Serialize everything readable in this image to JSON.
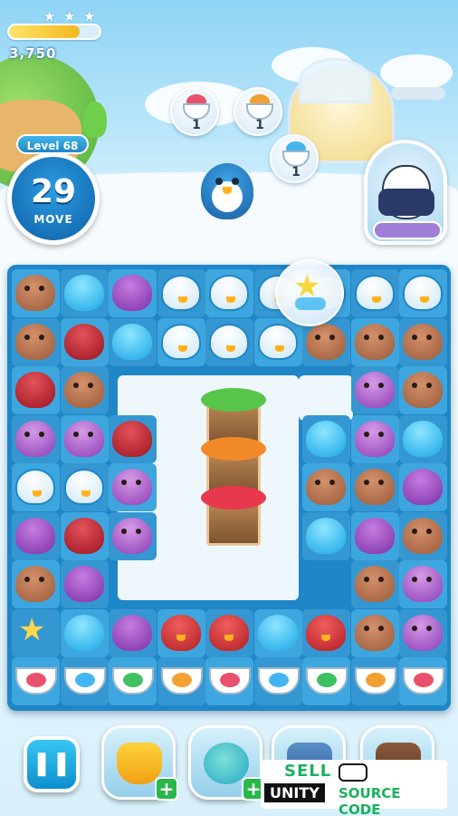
{
  "hud": {
    "score": "3,750",
    "score_progress": 0.78,
    "stars_earned": 0,
    "level_label": "Level 68",
    "moves_left": "29",
    "moves_label": "MOVE"
  },
  "goals": [
    {
      "item": "red-fruit-cup",
      "count": "1",
      "fruit_color": "#e8506c"
    },
    {
      "item": "orange-fruit-cup",
      "count": "1",
      "fruit_color": "#f3a032"
    },
    {
      "item": "blue-fruit-cup",
      "count": "1",
      "fruit_color": "#44b5f0"
    }
  ],
  "colors": {
    "board": "#1f86c7",
    "tile": "#3ea6de",
    "accent_blue": "#0d8fcf",
    "plus_green": "#28b84a"
  },
  "boosters": [
    {
      "name": "snorkel-booster",
      "icon": "snorkel-icon"
    },
    {
      "name": "pufferfish-booster",
      "icon": "pufferfish-icon"
    },
    {
      "name": "bucket-booster",
      "icon": "bucket-icon"
    },
    {
      "name": "pot-booster",
      "icon": "pot-icon"
    }
  ],
  "controls": {
    "pause_glyph": "❚❚",
    "plus_glyph": "+"
  },
  "watermark": {
    "line1": "SELL",
    "line2a": "UNITY",
    "line2b": "SOURCE CODE"
  }
}
